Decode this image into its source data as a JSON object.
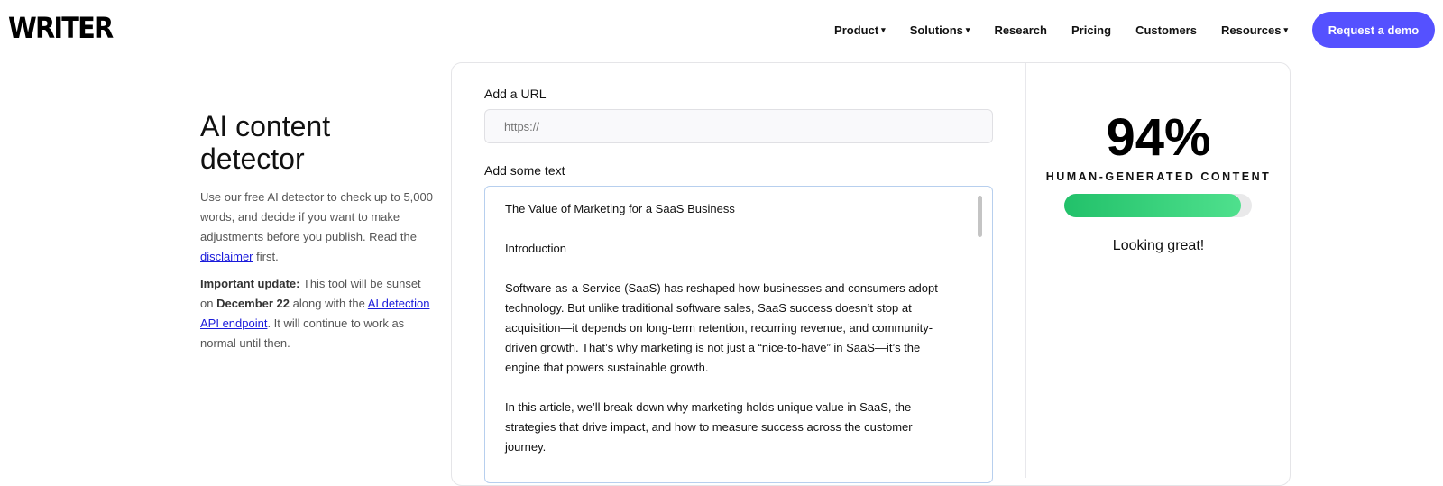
{
  "brand": {
    "logo_text": "WRITER"
  },
  "nav": {
    "items": [
      {
        "label": "Product",
        "dropdown": true
      },
      {
        "label": "Solutions",
        "dropdown": true
      },
      {
        "label": "Research",
        "dropdown": false
      },
      {
        "label": "Pricing",
        "dropdown": false
      },
      {
        "label": "Customers",
        "dropdown": false
      },
      {
        "label": "Resources",
        "dropdown": true
      }
    ],
    "cta_label": "Request a demo"
  },
  "intro": {
    "title": "AI content detector",
    "desc_before": "Use our free AI detector to check up to 5,000 words, and decide if you want to make adjustments before you publish. Read the ",
    "desc_link": "disclaimer",
    "desc_after": " first.",
    "update_label": "Important update:",
    "update_text_1": " This tool will be sunset on ",
    "update_date": "December 22",
    "update_text_2": " along with the ",
    "update_link": "AI detection API endpoint",
    "update_text_3": ". It will continue to work as normal until then."
  },
  "form": {
    "url_label": "Add a URL",
    "url_placeholder": "https://",
    "url_value": "",
    "text_label": "Add some text",
    "text_paragraphs": [
      "The Value of Marketing for a SaaS Business",
      "Introduction",
      "Software-as-a-Service (SaaS) has reshaped how businesses and consumers adopt technology. But unlike traditional software sales, SaaS success doesn’t stop at acquisition—it depends on long-term retention, recurring revenue, and community-driven growth. That’s why marketing is not just a “nice-to-have” in SaaS—it’s the engine that powers sustainable growth.",
      "In this article, we’ll break down why marketing holds unique value in SaaS, the strategies that drive impact, and how to measure success across the customer journey."
    ]
  },
  "result": {
    "score_text": "94%",
    "score_value": 94,
    "label": "HUMAN-GENERATED CONTENT",
    "verdict": "Looking great!",
    "bar_color": "#2ecf75"
  },
  "colors": {
    "accent": "#5551ff",
    "link": "#1a1adb"
  },
  "icons": {
    "dropdown": "caret-down-icon"
  }
}
